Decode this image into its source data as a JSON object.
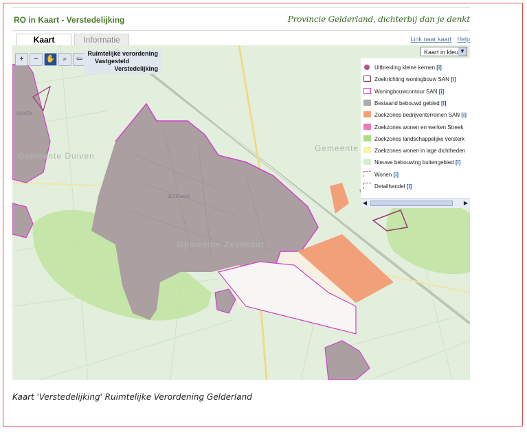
{
  "app": {
    "title": "RO in Kaart - Verstedelijking",
    "tagline": "Provincie Gelderland, dichterbij dan je denkt"
  },
  "tabs": [
    {
      "label": "Kaart",
      "active": true
    },
    {
      "label": "Informatie",
      "active": false
    }
  ],
  "links": {
    "map_link": "Link naar kaart",
    "help": "Help"
  },
  "map": {
    "layer_info": [
      "Ruimtelijke verordening",
      "Vastgesteld",
      "Verstedelijking"
    ],
    "base_select": "Kaart in kleur",
    "place_labels": [
      "Gemeente Duiven",
      "Gemeente Zevenaar",
      "Gemeente",
      "ZEVENAAR",
      "DUIVEN"
    ],
    "toolbar": [
      "zoom-in-icon",
      "zoom-out-icon",
      "pan-hand-icon",
      "zoom-extent-icon",
      "back-arrow-icon"
    ]
  },
  "legend": {
    "items": [
      {
        "label": "Uitbreiding kleine kernen",
        "info": "[i]",
        "color": "#b0558a",
        "shape": "dot"
      },
      {
        "label": "Zoekrichting woningbouw SAN",
        "info": "[i]",
        "color": "#8a2b60",
        "shape": "outline"
      },
      {
        "label": "Woningbouwcontour SAN",
        "info": "[i]",
        "color": "#d63fd0",
        "shape": "outline"
      },
      {
        "label": "Bestaand bebouwd gebied",
        "info": "[i]",
        "color": "#ababab",
        "shape": "fill"
      },
      {
        "label": "Zoekzones bedrijventerreinen SAN",
        "info": "[i]",
        "color": "#f2a07a",
        "shape": "fill"
      },
      {
        "label": "Zoekzones wonen en werken Streek",
        "info": "",
        "color": "#f07ab8",
        "shape": "fill"
      },
      {
        "label": "Zoekzones landschappelijke versterk",
        "info": "",
        "color": "#a8e080",
        "shape": "fill"
      },
      {
        "label": "Zoekzones wonen in lage dichtheden",
        "info": "",
        "color": "#f8f3a8",
        "shape": "fill"
      },
      {
        "label": "Nieuwe bebouwing buitengebied",
        "info": "[i]",
        "color": "#d8edcf",
        "shape": "fill"
      },
      {
        "label": "Wonen",
        "info": "[i]",
        "color": "#c86aa8",
        "shape": "dashed"
      },
      {
        "label": "Detailhandel",
        "info": "[i]",
        "color": "#9a4a7a",
        "shape": "dashed"
      }
    ]
  },
  "caption": "Kaart 'Verstedelijking' Ruimtelijke Verordening Gelderland"
}
